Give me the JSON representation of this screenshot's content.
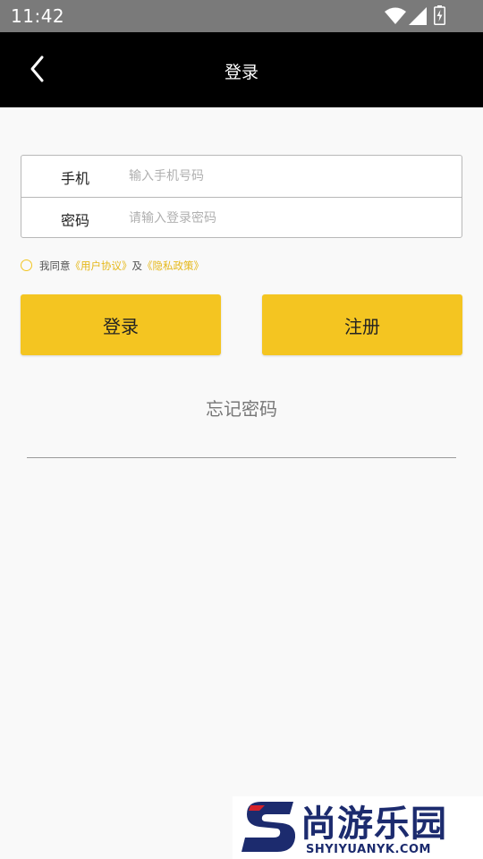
{
  "status_bar": {
    "time": "11:42",
    "icons": [
      "wifi-icon",
      "signal-icon",
      "battery-charging-icon"
    ]
  },
  "app_bar": {
    "title": "登录",
    "back_icon": "chevron-left-icon"
  },
  "form": {
    "phone": {
      "label": "手机",
      "placeholder": "输入手机号码",
      "value": ""
    },
    "password": {
      "label": "密码",
      "placeholder": "请输入登录密码",
      "value": ""
    }
  },
  "agreement": {
    "prefix": "我同意",
    "user_agreement": "《用户协议》",
    "conjunction": "及",
    "privacy_policy": "《隐私政策》",
    "checked": false
  },
  "buttons": {
    "login": "登录",
    "register": "注册"
  },
  "forgot_password": "忘记密码",
  "watermark": {
    "brand": "尚游乐园",
    "url": "SHYIYUANYK.COM"
  },
  "colors": {
    "accent": "#f4c521",
    "link": "#e5b81a",
    "app_bar": "#000000",
    "status_bar": "#7a7a7a",
    "background": "#f9f9f9"
  }
}
